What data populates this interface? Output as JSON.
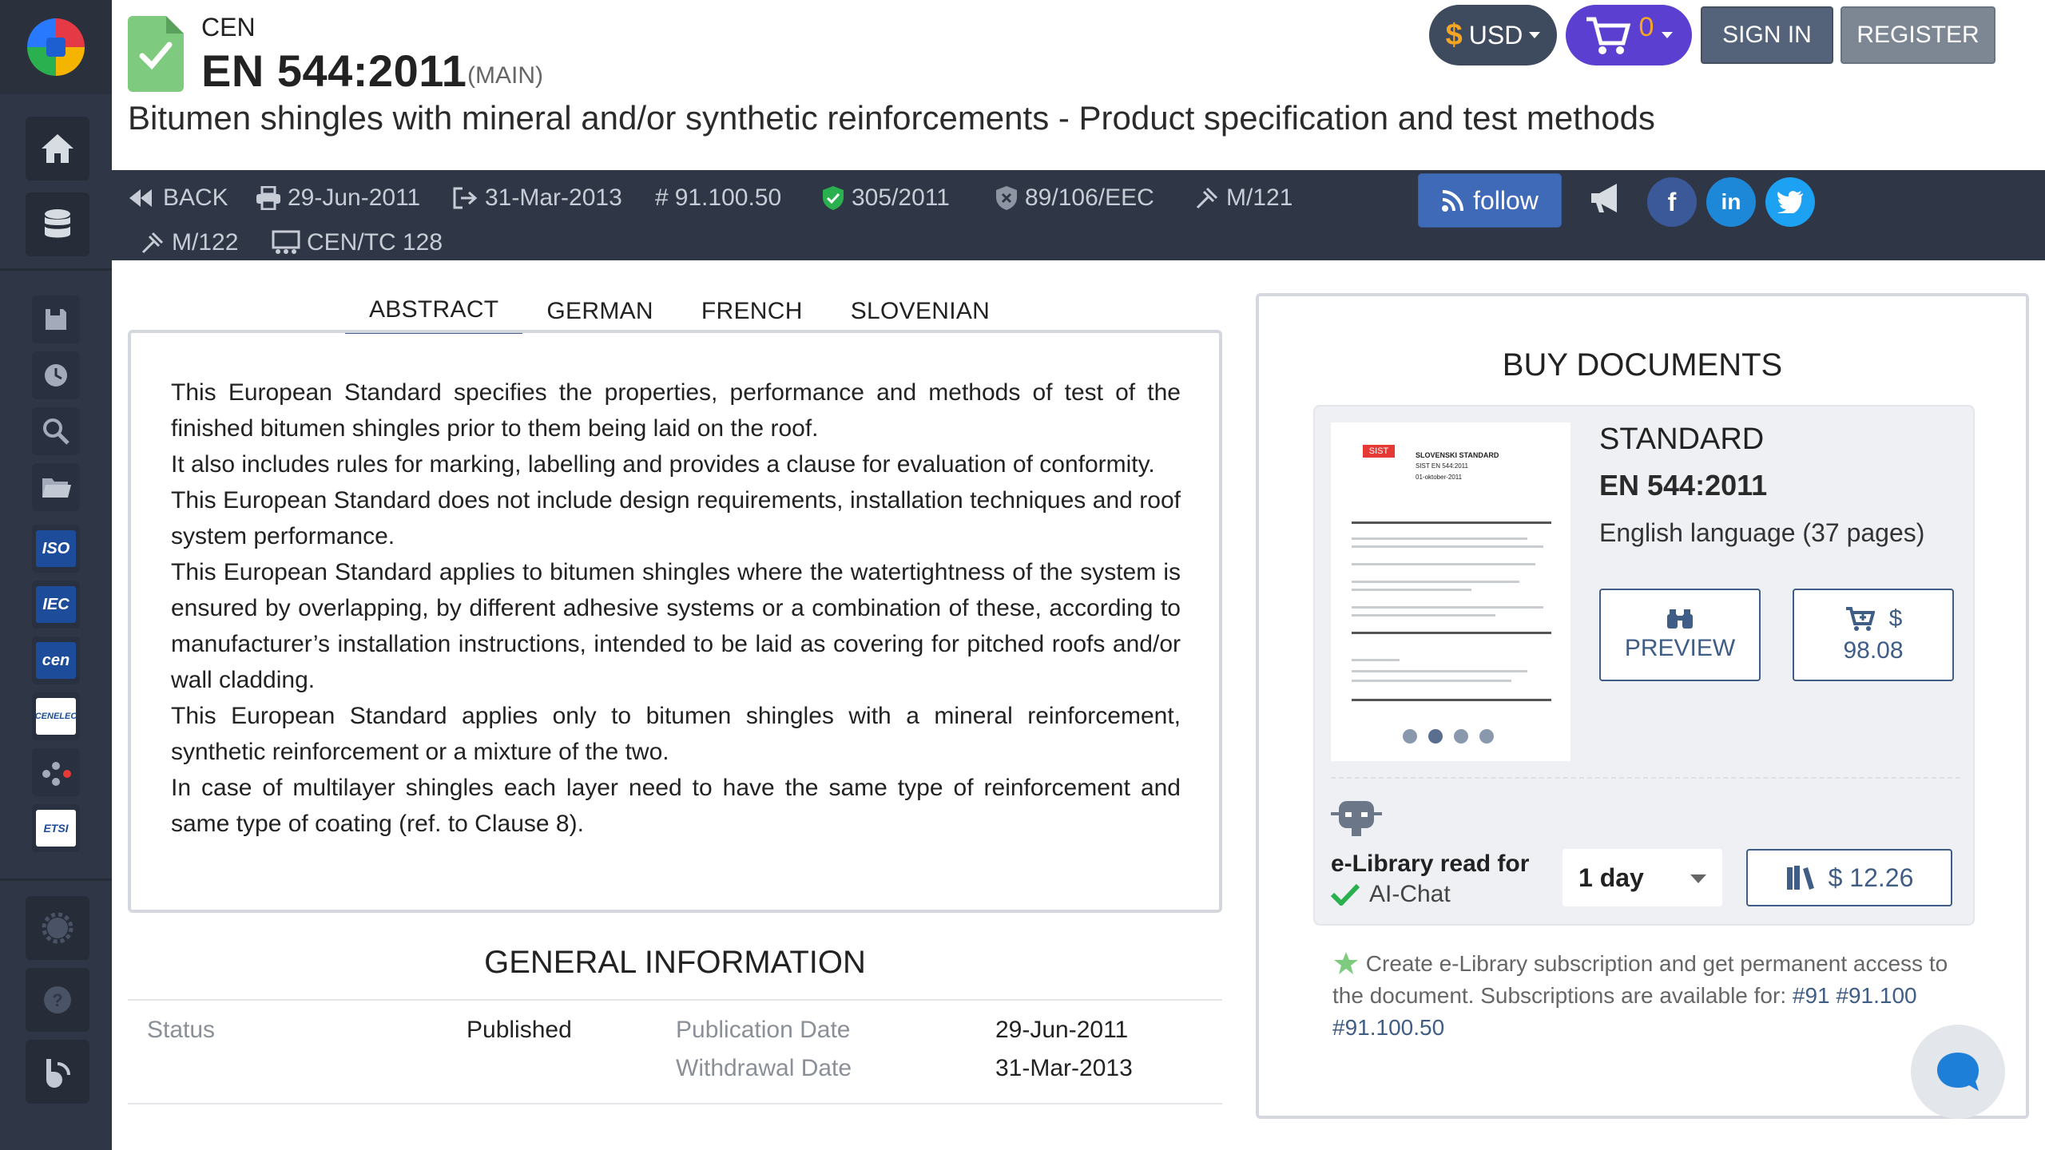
{
  "sidebar": {
    "icons": [
      "logo",
      "home-icon",
      "database-icon",
      "save-icon",
      "history-icon",
      "search-icon",
      "folder-icon",
      "iso-badge",
      "iec-badge",
      "cen-badge",
      "cenelec-badge",
      "dots-icon",
      "etsi-badge",
      "settings-icon",
      "help-icon",
      "blog-icon"
    ],
    "badges": {
      "iso": "ISO",
      "iec": "IEC",
      "cen": "cen",
      "cenelec": "CENELEC",
      "etsi": "ETSI"
    }
  },
  "header": {
    "org": "CEN",
    "code": "EN 544:2011",
    "variant": "(MAIN)",
    "title": "Bitumen shingles with mineral and/or synthetic reinforcements - Product specification and test methods",
    "currency": "USD",
    "cart_count": "0",
    "sign_in": "SIGN IN",
    "register": "REGISTER"
  },
  "meta": {
    "back": "BACK",
    "publication_date": "29-Jun-2011",
    "withdrawal_date": "31-Mar-2013",
    "ics": "91.100.50",
    "regulation": "305/2011",
    "directive": "89/106/EEC",
    "mandate1": "M/121",
    "mandate2": "M/122",
    "committee": "CEN/TC 128",
    "follow": "follow",
    "social": [
      "facebook",
      "linkedin",
      "twitter"
    ]
  },
  "tabs": [
    "ABSTRACT",
    "GERMAN",
    "FRENCH",
    "SLOVENIAN"
  ],
  "abstract": [
    "This European Standard specifies the properties, performance and methods of test of the finished bitumen shingles prior to them being laid on the roof.",
    "It also includes rules for marking, labelling and provides a clause for evaluation of conformity.",
    "This European Standard does not include design requirements, installation techniques and roof system performance.",
    "This European Standard applies to bitumen shingles where the watertightness of the system is ensured by overlapping, by different adhesive systems or a combination of these, according to manufacturer’s installation instructions, intended to be laid as covering for pitched roofs and/or wall cladding.",
    "This European Standard applies only to bitumen shingles with a mineral reinforcement, synthetic reinforcement or a mixture of the two.",
    "In case of multilayer shingles each layer need to have the same type of reinforcement and same type of coating (ref. to Clause 8)."
  ],
  "general_info": {
    "title": "GENERAL INFORMATION",
    "status_label": "Status",
    "status_value": "Published",
    "pub_label": "Publication Date",
    "pub_value": "29-Jun-2011",
    "wd_label": "Withdrawal Date",
    "wd_value": "31-Mar-2013"
  },
  "buy": {
    "title": "BUY DOCUMENTS",
    "type": "STANDARD",
    "code": "EN 544:2011",
    "language": "English language (37 pages)",
    "preview": "PREVIEW",
    "price_symbol": "$",
    "price": "98.08",
    "elib_label": "e-Library read for",
    "ai_chat": "AI-Chat",
    "period": "1 day",
    "elib_price": "$ 12.26",
    "note_text": "Create e-Library subscription and get permanent access to the document. Subscriptions are available for:",
    "note_links": [
      "#91",
      "#91.100",
      "#91.100.50"
    ],
    "thumb": {
      "brand": "SIST",
      "heading": "SLOVENSKI STANDARD",
      "code": "SIST EN 544:2011",
      "date": "01-oktober-2011"
    }
  },
  "colors": {
    "sidebar": "#2f3746",
    "accent": "#3f5d85",
    "cart": "#5b3fd1",
    "follow": "#3f6ab7"
  }
}
